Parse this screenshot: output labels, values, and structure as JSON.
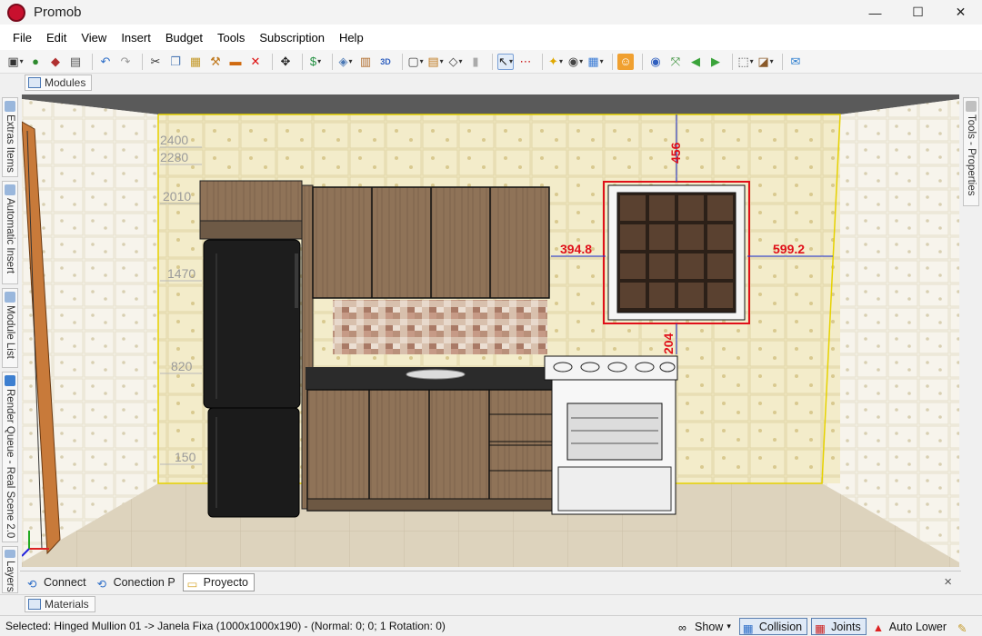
{
  "window": {
    "title": "Promob",
    "minimize": "—",
    "maximize": "☐",
    "close": "✕"
  },
  "menu": [
    "File",
    "Edit",
    "View",
    "Insert",
    "Budget",
    "Tools",
    "Subscription",
    "Help"
  ],
  "modules_tab": "Modules",
  "left_tabs": [
    "Extras Items",
    "Automatic Insert",
    "Module List",
    "Render Queue - Real Scene 2.0",
    "Layers"
  ],
  "right_tabs": [
    "Tools - Properties"
  ],
  "viewport": {
    "height_marks": [
      "2400",
      "2280",
      "2010",
      "1470",
      "820",
      "150"
    ],
    "dimensions": {
      "left": "394.8",
      "right": "599.2",
      "top": "456",
      "bottom": "204"
    }
  },
  "bottom_tabs": [
    {
      "label": "Connect",
      "active": false
    },
    {
      "label": "Conection P",
      "active": false
    },
    {
      "label": "Proyecto",
      "active": true
    }
  ],
  "close_panel": "×",
  "materials_tab": "Materials",
  "status": {
    "text": "Selected: Hinged Mullion 01 -> Janela Fixa (1000x1000x190) - (Normal: 0; 0; 1 Rotation: 0)",
    "show": "Show",
    "collision": "Collision",
    "joints": "Joints",
    "auto_lower": "Auto Lower"
  },
  "colors": {
    "accent": "#c8102e",
    "dimension": "#e0101a",
    "dimension_line": "#1a2fd6"
  }
}
